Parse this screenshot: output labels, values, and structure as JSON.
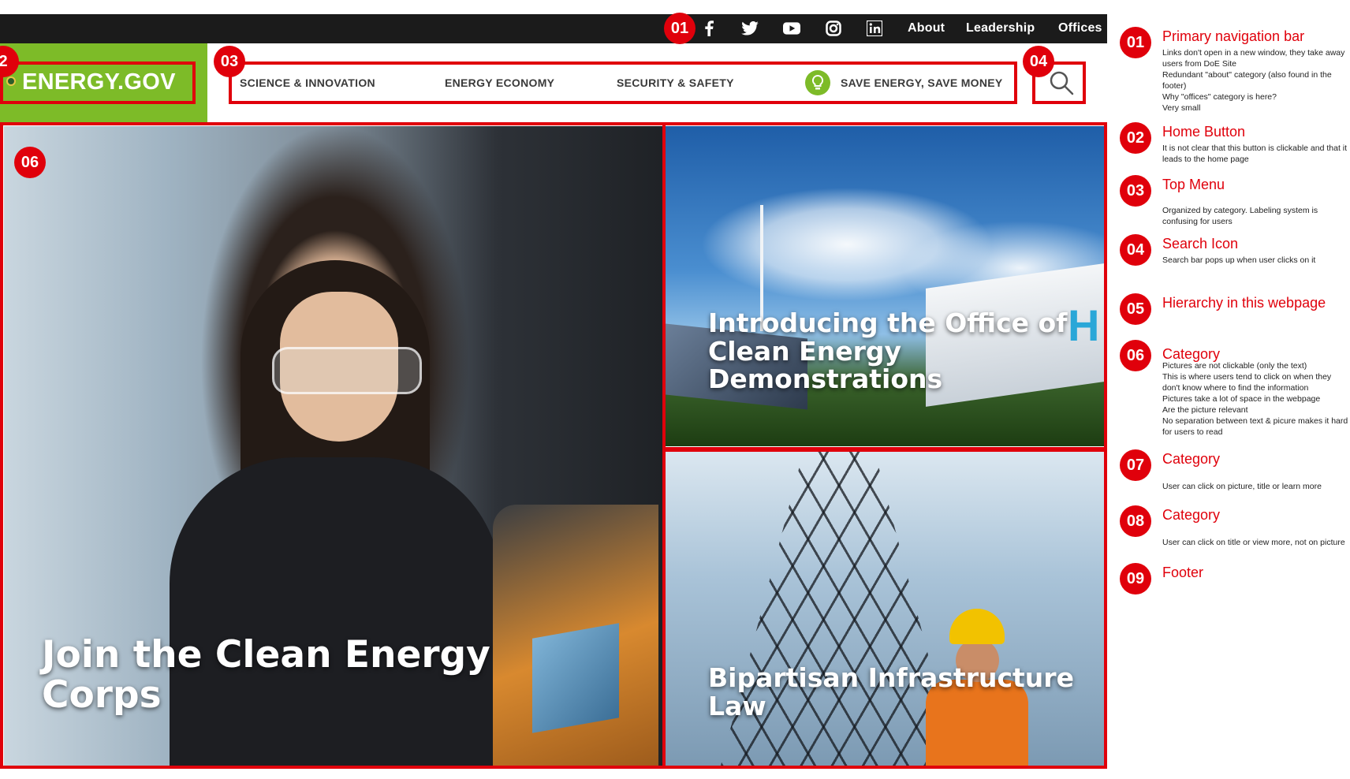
{
  "topbar": {
    "social_icons": [
      "facebook-icon",
      "twitter-icon",
      "youtube-icon",
      "instagram-icon",
      "linkedin-icon"
    ],
    "links": [
      "About",
      "Leadership",
      "Offices"
    ]
  },
  "logo": {
    "text": "ENERGY.GOV"
  },
  "nav": {
    "items": [
      "SCIENCE & INNOVATION",
      "ENERGY ECONOMY",
      "SECURITY & SAFETY",
      "SAVE ENERGY, SAVE MONEY"
    ],
    "search_icon": "search-icon"
  },
  "tiles": {
    "main_title": "Join the Clean Energy Corps",
    "ocd_title": "Introducing the Office of Clean Energy Demonstrations",
    "bil_title": "Bipartisan Infrastructure Law"
  },
  "annotation_badges": {
    "b01": "01",
    "b02": "2",
    "b03": "03",
    "b04": "04",
    "b06": "06"
  },
  "legend": [
    {
      "num": "01",
      "title": "Primary navigation bar",
      "desc": "Links don't open in a new window, they take away users from DoE Site\nRedundant \"about\" category (also found in the footer)\nWhy \"offices\" category is here?\nVery small"
    },
    {
      "num": "02",
      "title": "Home Button",
      "desc": "It is not clear that this button is clickable and that it leads to the home page"
    },
    {
      "num": "03",
      "title": "Top Menu",
      "desc": "Organized by category. Labeling system is confusing for users"
    },
    {
      "num": "04",
      "title": "Search Icon",
      "desc": "Search bar pops up when user clicks on it"
    },
    {
      "num": "05",
      "title": "Hierarchy in this webpage",
      "desc": ""
    },
    {
      "num": "06",
      "title": "Category",
      "desc": "Pictures are not clickable (only the text)\nThis is where users tend to click on when they don't know where to find the information\nPictures take a lot of space in the webpage\nAre the picture relevant\nNo separation between text & picure makes it hard for users to read"
    },
    {
      "num": "07",
      "title": "Category",
      "desc": "User can click on picture, title or learn more"
    },
    {
      "num": "08",
      "title": "Category",
      "desc": "User can click on title or view more, not on picture"
    },
    {
      "num": "09",
      "title": "Footer",
      "desc": ""
    }
  ],
  "colors": {
    "annotation_red": "#e0000b",
    "brand_green": "#7dbb28",
    "topbar_black": "#1b1b1b"
  }
}
